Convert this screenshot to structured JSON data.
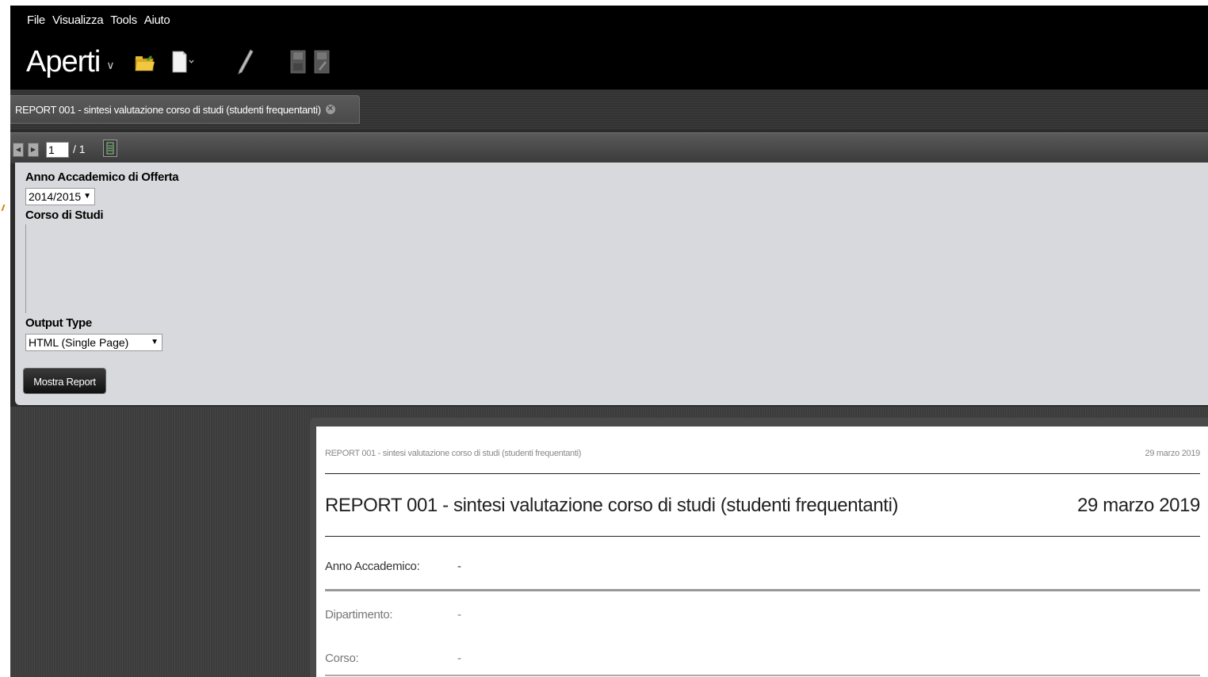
{
  "menu": [
    "File",
    "Visualizza",
    "Tools",
    "Aiuto"
  ],
  "toolbar": {
    "open_label": "Aperti",
    "icons": [
      "folder-open-icon",
      "new-document-icon",
      "pencil-icon",
      "save-icon",
      "save-as-icon"
    ]
  },
  "tab": {
    "label": "REPORT 001 - sintesi valutazione corso di studi (studenti frequentanti)"
  },
  "pager": {
    "current": "1",
    "total": "/ 1"
  },
  "params": {
    "anno_label": "Anno Accademico di Offerta",
    "anno_value": "2014/2015",
    "corso_label": "Corso di Studi",
    "output_label": "Output Type",
    "output_value": "HTML (Single Page)",
    "submit_label": "Mostra Report"
  },
  "report": {
    "header_title": "REPORT 001 - sintesi valutazione corso di studi (studenti frequentanti)",
    "header_date": "29 marzo 2019",
    "title": "REPORT 001 - sintesi valutazione corso di studi (studenti frequentanti)",
    "date": "29 marzo 2019",
    "rows": [
      {
        "label": "Anno Accademico:",
        "value": "-"
      },
      {
        "label": "Dipartimento:",
        "value": "-"
      },
      {
        "label": "Corso:",
        "value": "-"
      }
    ]
  },
  "colors": {
    "header_bg": "#000000",
    "panel_bg": "#d8d9dc",
    "workspace_bg": "#3c3c3c",
    "accent_marker": "#e07a00"
  }
}
